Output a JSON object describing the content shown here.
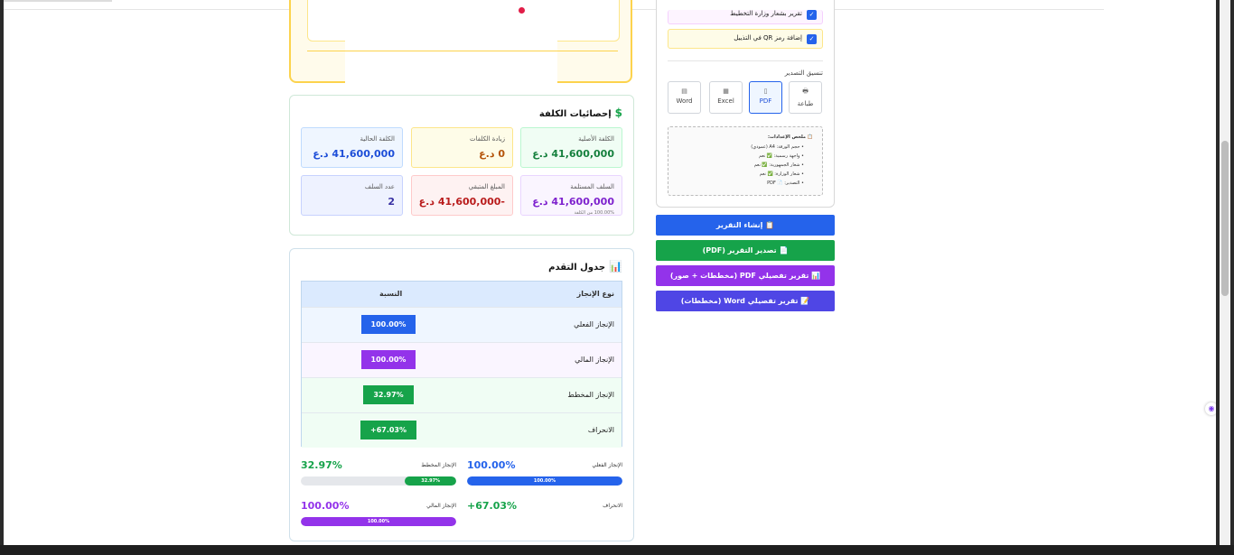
{
  "cost_stats": {
    "title": "إحصائيات الكلفة",
    "icon": "dollar-icon",
    "items": [
      {
        "label": "الكلفة الأصلية",
        "value": "41,600,000 د.ع",
        "color": "#15803d",
        "bg": "#f0fdf4",
        "border": "#bbf7d0"
      },
      {
        "label": "زيادة الكلفات",
        "value": "0 د.ع",
        "color": "#b45309",
        "bg": "#fefce8",
        "border": "#fde68a"
      },
      {
        "label": "الكلفة الحالية",
        "value": "41,600,000 د.ع",
        "color": "#1d4ed8",
        "bg": "#eff6ff",
        "border": "#bfdbfe"
      },
      {
        "label": "السلف المستلمة",
        "value": "41,600,000 د.ع",
        "sub": "100.00% من الكلفة",
        "color": "#7e22ce",
        "bg": "#faf5ff",
        "border": "#e9d5ff"
      },
      {
        "label": "المبلغ المتبقي",
        "value": "-41,600,000 د.ع",
        "color": "#b91c1c",
        "bg": "#fef2f2",
        "border": "#fecaca"
      },
      {
        "label": "عدد السلف",
        "value": "2",
        "color": "#3730a3",
        "bg": "#eef2ff",
        "border": "#c7d2fe"
      }
    ]
  },
  "progress_table": {
    "title": "جدول التقدم",
    "icon": "bar-chart-icon",
    "headers": {
      "type": "نوع الإنجاز",
      "percent": "النسبة"
    },
    "rows": [
      {
        "name": "الإنجاز الفعلي",
        "value": "100.00%",
        "color": "#2563eb",
        "bg": "#eff6ff"
      },
      {
        "name": "الإنجاز المالي",
        "value": "100.00%",
        "color": "#9333ea",
        "bg": "#faf5ff"
      },
      {
        "name": "الإنجاز المخطط",
        "value": "32.97%",
        "color": "#16a34a",
        "bg": "#f0fdf4"
      },
      {
        "name": "الانحراف",
        "value": "+67.03%",
        "color": "#16a34a",
        "bg": "#f0fdf4"
      }
    ]
  },
  "progress_bars": [
    {
      "label": "الإنجاز الفعلي",
      "value": "100.00%",
      "fill": 1.0,
      "color": "#2563eb"
    },
    {
      "label": "الإنجاز المخطط",
      "value": "32.97%",
      "fill": 0.3297,
      "color": "#16a34a"
    },
    {
      "label": "الانحراف",
      "value": "+67.03%",
      "color": "#16a34a"
    },
    {
      "label": "الإنجاز المالي",
      "value": "100.00%",
      "fill": 1.0,
      "color": "#9333ea"
    }
  ],
  "settings": {
    "checkboxes": [
      {
        "label": "تقرير بشعار وزارة التخطيط",
        "checked": true
      },
      {
        "label": "إضافة رمز QR في التذييل",
        "checked": true
      }
    ],
    "export_format_label": "تنسيق التصدير",
    "formats": [
      {
        "label": "طباعة",
        "icon": "printer-icon",
        "glyph": "🖶"
      },
      {
        "label": "PDF",
        "icon": "pdf-file-icon",
        "glyph": "▯",
        "selected": true
      },
      {
        "label": "Excel",
        "icon": "excel-icon",
        "glyph": "▦"
      },
      {
        "label": "Word",
        "icon": "word-icon",
        "glyph": "▤"
      }
    ],
    "summary": {
      "title": "📋 ملخص الإعدادات:",
      "lines": [
        "• حجم الورقة: A4 (عمودي)",
        "• واجهة رسمية: ✅ نعم",
        "• شعار الجمهورية: ✅ نعم",
        "• شعار الوزارة: ✅ نعم",
        "• التصدير: 📄 PDF"
      ]
    }
  },
  "actions": [
    {
      "label": "📋 إنشاء التقرير",
      "color": "#2563eb"
    },
    {
      "label": "📄 تصدير التقرير (PDF)",
      "color": "#16a34a"
    },
    {
      "label": "📊 تقرير تفصيلي PDF (مخططات + صور)",
      "color": "#9333ea"
    },
    {
      "label": "📝 تقرير تفصيلي Word (مخططات)",
      "color": "#4f46e5"
    }
  ]
}
